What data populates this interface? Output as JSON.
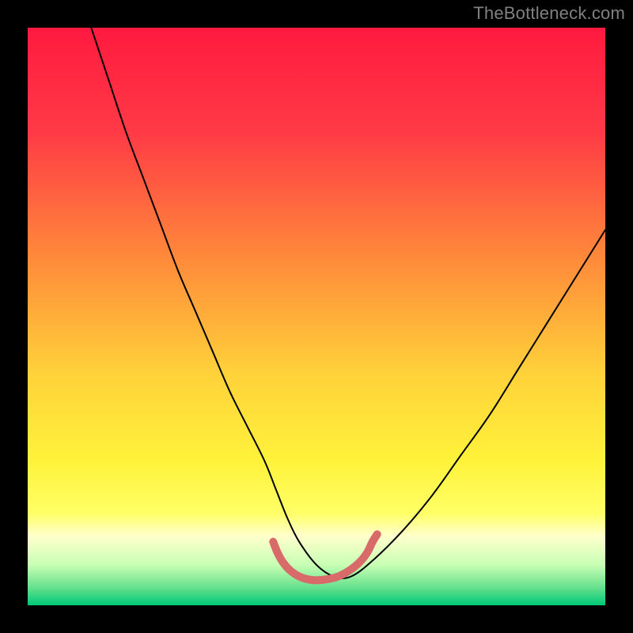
{
  "watermark": {
    "text": "TheBottleneck.com"
  },
  "chart_data": {
    "type": "line",
    "title": "",
    "xlabel": "",
    "ylabel": "",
    "xlim": [
      0,
      100
    ],
    "ylim": [
      0,
      100
    ],
    "gradient_stops": [
      {
        "offset": 0,
        "color": "#ff1a3f"
      },
      {
        "offset": 18,
        "color": "#ff3a46"
      },
      {
        "offset": 40,
        "color": "#ff8a3a"
      },
      {
        "offset": 60,
        "color": "#ffd23a"
      },
      {
        "offset": 75,
        "color": "#fff23a"
      },
      {
        "offset": 84,
        "color": "#ffff66"
      },
      {
        "offset": 88,
        "color": "#ffffcc"
      },
      {
        "offset": 93,
        "color": "#c8ffb4"
      },
      {
        "offset": 97,
        "color": "#64e08c"
      },
      {
        "offset": 100,
        "color": "#00c878"
      }
    ],
    "series": [
      {
        "name": "bottleneck-curve",
        "color": "#000000",
        "width": 2,
        "x": [
          11,
          14,
          17,
          20,
          23,
          26,
          29,
          32,
          35,
          38,
          41,
          43,
          45,
          47,
          50,
          53,
          56,
          60,
          65,
          70,
          75,
          80,
          85,
          90,
          95,
          100
        ],
        "values": [
          100,
          91,
          82,
          74,
          66,
          58,
          51,
          44,
          37,
          31,
          25,
          20,
          15,
          11,
          7,
          5,
          5,
          8,
          13,
          19,
          26,
          33,
          41,
          49,
          57,
          65
        ]
      },
      {
        "name": "bottom-segment",
        "color": "#d86a6a",
        "width": 10,
        "linecap": "round",
        "x": [
          42.5,
          43.3,
          44.3,
          45.6,
          47.2,
          49.0,
          51.0,
          53.5,
          55.5,
          57.3,
          58.7,
          59.7,
          60.5
        ],
        "values": [
          11.0,
          9.0,
          7.3,
          5.9,
          4.9,
          4.4,
          4.4,
          4.9,
          5.9,
          7.3,
          9.0,
          11.0,
          12.3
        ]
      }
    ]
  }
}
